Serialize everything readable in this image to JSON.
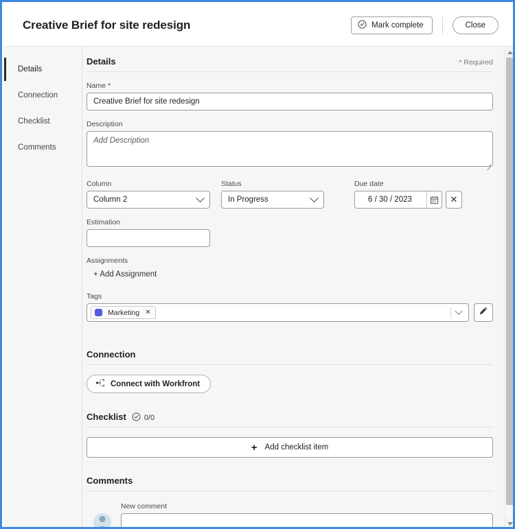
{
  "header": {
    "title": "Creative Brief for site redesign",
    "mark_complete_label": "Mark complete",
    "close_label": "Close"
  },
  "sidebar": {
    "items": [
      {
        "label": "Details"
      },
      {
        "label": "Connection"
      },
      {
        "label": "Checklist"
      },
      {
        "label": "Comments"
      }
    ]
  },
  "details": {
    "heading": "Details",
    "required_note": "* Required",
    "name": {
      "label": "Name",
      "required_mark": "*",
      "value": "Creative Brief for site redesign"
    },
    "description": {
      "label": "Description",
      "placeholder": "Add Description",
      "value": ""
    },
    "column": {
      "label": "Column",
      "value": "Column 2"
    },
    "status": {
      "label": "Status",
      "value": "In Progress"
    },
    "due_date": {
      "label": "Due date",
      "value": "6 / 30 / 2023",
      "clear_label": "✕"
    },
    "estimation": {
      "label": "Estimation",
      "value": ""
    },
    "assignments": {
      "label": "Assignments",
      "add_label": "+ Add Assignment"
    },
    "tags": {
      "label": "Tags",
      "chips": [
        {
          "label": "Marketing",
          "color": "#515ce0",
          "remove_label": "✕"
        }
      ]
    }
  },
  "connection": {
    "heading": "Connection",
    "connect_label": "Connect with Workfront"
  },
  "checklist": {
    "heading": "Checklist",
    "count": "0/0",
    "add_item_label": "Add checklist item",
    "add_item_plus": "+"
  },
  "comments": {
    "heading": "Comments",
    "new_comment_label": "New comment",
    "new_comment_value": ""
  },
  "colors": {
    "window_border": "#3c8ae0",
    "tag_marketing": "#515ce0",
    "body_background": "#f6f6f6",
    "active_nav_bar": "#2b2b2b"
  }
}
